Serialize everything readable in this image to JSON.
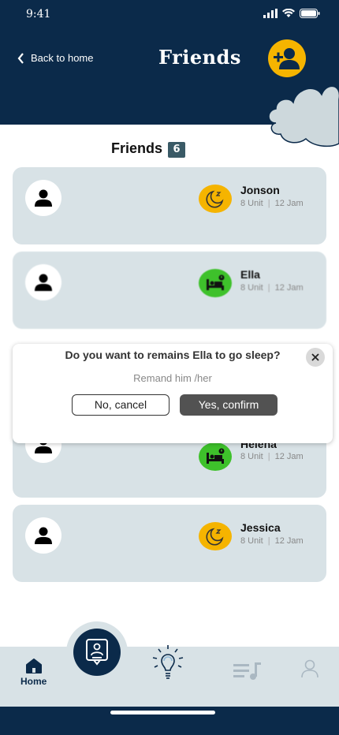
{
  "status_bar": {
    "time": "9:41"
  },
  "header": {
    "back_label": "Back to home",
    "title": "Friends"
  },
  "section": {
    "title": "Friends",
    "count": "6"
  },
  "friends": [
    {
      "name": "Jonson",
      "unit": "8 Unit",
      "time": "12 Jam",
      "status": "sleep"
    },
    {
      "name": "Ella",
      "unit": "8 Unit",
      "time": "12 Jam",
      "status": "bed"
    },
    {
      "name": "Helena",
      "unit": "8 Unit",
      "time": "12 Jam",
      "status": "bed"
    },
    {
      "name": "Jessica",
      "unit": "8 Unit",
      "time": "12 Jam",
      "status": "sleep"
    }
  ],
  "dialog": {
    "question": "Do you want to remains Ella to go sleep?",
    "subtitle": "Remand him /her",
    "cancel_label": "No, cancel",
    "confirm_label": "Yes, confirm"
  },
  "tabbar": {
    "items": [
      {
        "label": "Home",
        "icon": "home-icon"
      },
      {
        "label": "",
        "icon": "profile-card-icon"
      },
      {
        "label": "",
        "icon": "lightbulb-icon"
      },
      {
        "label": "",
        "icon": "playlist-icon"
      },
      {
        "label": "",
        "icon": "user-icon"
      }
    ]
  },
  "colors": {
    "navy": "#0b2a4a",
    "card": "#d8e2e6",
    "yellow": "#f5b400",
    "green": "#3ec12b"
  }
}
